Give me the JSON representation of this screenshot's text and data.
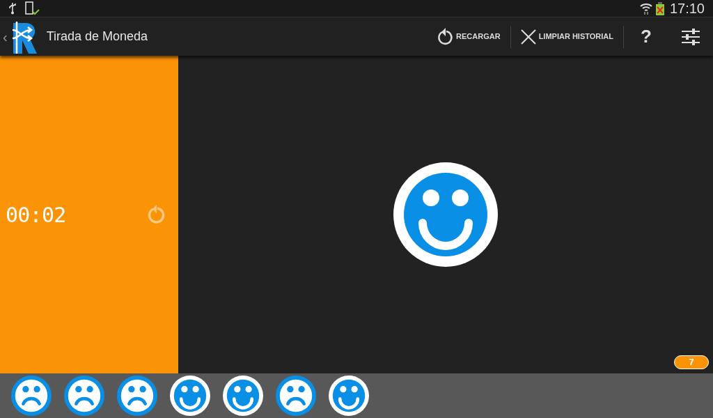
{
  "status_bar": {
    "time": "17:10"
  },
  "action_bar": {
    "back": "‹",
    "title": "Tirada de Moneda",
    "actions": [
      {
        "kind": "reload",
        "label": "RECARGAR"
      },
      {
        "kind": "clear",
        "label": "LIMPIAR HISTORIAL"
      },
      {
        "kind": "help",
        "label": "?"
      },
      {
        "kind": "settings"
      }
    ]
  },
  "timer": {
    "value": "00:02"
  },
  "result": {
    "kind": "happy"
  },
  "count": "7",
  "history": [
    {
      "kind": "sad"
    },
    {
      "kind": "sad"
    },
    {
      "kind": "sad"
    },
    {
      "kind": "happy"
    },
    {
      "kind": "happy"
    },
    {
      "kind": "sad"
    },
    {
      "kind": "happy"
    }
  ]
}
